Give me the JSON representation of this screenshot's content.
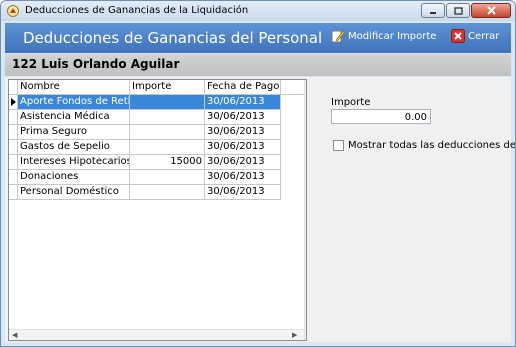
{
  "window": {
    "title": "Deducciones de Ganancias de la Liquidación"
  },
  "header": {
    "title": "Deducciones de Ganancias del Personal",
    "modify_label": "Modificar Importe",
    "close_label": "Cerrar"
  },
  "employee": {
    "label": "122 Luis Orlando Aguilar"
  },
  "grid": {
    "columns": [
      "Nombre",
      "Importe",
      "Fecha de Pago"
    ],
    "rows": [
      {
        "nombre": "Aporte Fondos de Retiro",
        "importe": "",
        "fecha": "30/06/2013"
      },
      {
        "nombre": "Asistencia Médica",
        "importe": "",
        "fecha": "30/06/2013"
      },
      {
        "nombre": "Prima Seguro",
        "importe": "",
        "fecha": "30/06/2013"
      },
      {
        "nombre": "Gastos de Sepelio",
        "importe": "",
        "fecha": "30/06/2013"
      },
      {
        "nombre": "Intereses Hipotecarios",
        "importe": "15000",
        "fecha": "30/06/2013"
      },
      {
        "nombre": "Donaciones",
        "importe": "",
        "fecha": "30/06/2013"
      },
      {
        "nombre": "Personal Doméstico",
        "importe": "",
        "fecha": "30/06/2013"
      }
    ],
    "selected_row": 0
  },
  "side": {
    "importe_label": "Importe",
    "importe_value": "0.00",
    "show_all_label": "Mostrar todas las deducciones del año",
    "show_all_checked": false
  },
  "colors": {
    "header_bg": "#4a80c8",
    "selection": "#3a86d9",
    "employee_bar": "#c8c8c8"
  }
}
